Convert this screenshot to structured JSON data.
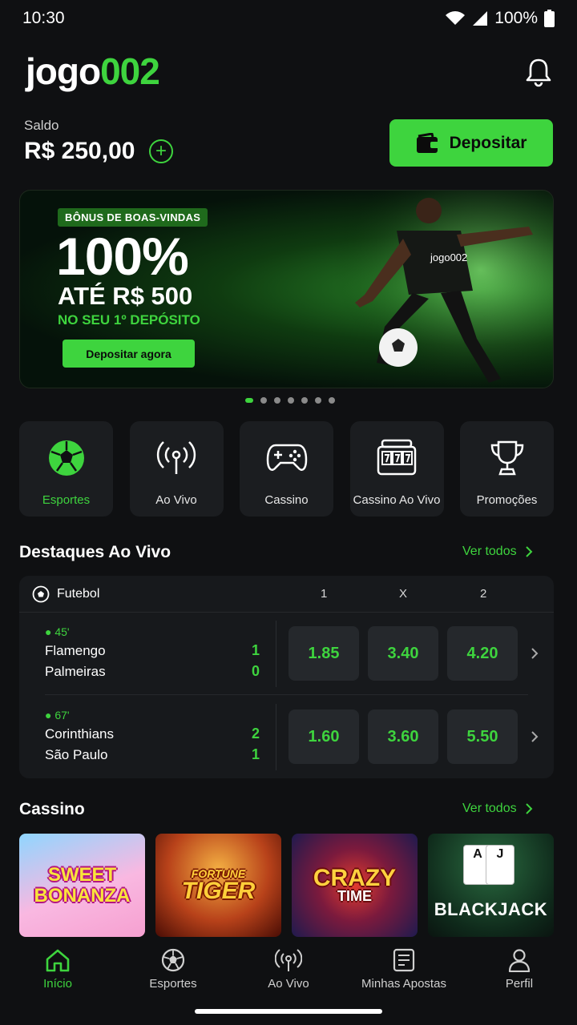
{
  "status": {
    "time": "10:30",
    "battery": "100%"
  },
  "header": {
    "logo_part1": "jogo",
    "logo_part2": "002"
  },
  "balance": {
    "label": "Saldo",
    "value": "R$ 250,00",
    "deposit_label": "Depositar"
  },
  "banner": {
    "tag": "BÔNUS DE BOAS-VINDAS",
    "headline": "100%",
    "line2": "ATÉ R$ 500",
    "line3": "NO SEU 1º DEPÓSITO",
    "cta": "Depositar agora",
    "jersey_text": "jogo002",
    "slides": 7,
    "active_slide": 1
  },
  "categories": [
    {
      "label": "Esportes",
      "icon": "soccer-ball-icon",
      "active": true
    },
    {
      "label": "Ao Vivo",
      "icon": "broadcast-icon",
      "active": false
    },
    {
      "label": "Cassino",
      "icon": "gamepad-icon",
      "active": false
    },
    {
      "label": "Cassino Ao Vivo",
      "icon": "slot-machine-icon",
      "active": false
    },
    {
      "label": "Promoções",
      "icon": "trophy-icon",
      "active": false
    }
  ],
  "live": {
    "title": "Destaques Ao Vivo",
    "see_all": "Ver todos",
    "sport": "Futebol",
    "col1": "1",
    "colx": "X",
    "col2": "2",
    "matches": [
      {
        "minute": "45'",
        "home": "Flamengo",
        "away": "Palmeiras",
        "home_score": "1",
        "away_score": "0",
        "odd1": "1.85",
        "oddx": "3.40",
        "odd2": "4.20"
      },
      {
        "minute": "67'",
        "home": "Corinthians",
        "away": "São Paulo",
        "home_score": "2",
        "away_score": "1",
        "odd1": "1.60",
        "oddx": "3.60",
        "odd2": "5.50"
      }
    ]
  },
  "casino": {
    "title": "Cassino",
    "see_all": "Ver todos",
    "games": [
      {
        "l1": "SWEET",
        "l2": "BONANZA"
      },
      {
        "l1": "FORTUNE",
        "l2": "TIGER"
      },
      {
        "l1": "CRAZY",
        "l2": "TIME"
      },
      {
        "l1": "BLACKJACK",
        "card1": "A",
        "card2": "J"
      }
    ]
  },
  "nav": [
    {
      "label": "Início",
      "icon": "home-icon",
      "active": true
    },
    {
      "label": "Esportes",
      "icon": "soccer-ball-icon",
      "active": false
    },
    {
      "label": "Ao Vivo",
      "icon": "broadcast-icon",
      "active": false
    },
    {
      "label": "Minhas Apostas",
      "icon": "bet-slip-icon",
      "active": false
    },
    {
      "label": "Perfil",
      "icon": "user-icon",
      "active": false
    }
  ],
  "colors": {
    "accent": "#3ed43e",
    "background": "#0f1012",
    "card": "#1b1d20"
  }
}
